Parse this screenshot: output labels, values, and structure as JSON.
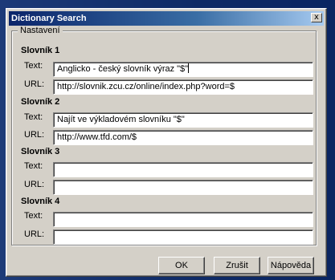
{
  "window": {
    "title": "Dictionary Search",
    "close_glyph": "x"
  },
  "group": {
    "label": "Nastavení"
  },
  "dictionaries": [
    {
      "title": "Slovník 1",
      "text_label": "Text:",
      "url_label": "URL:",
      "text_value": "Anglicko - český slovník výraz \"$\"",
      "url_value": "http://slovnik.zcu.cz/online/index.php?word=$"
    },
    {
      "title": "Slovník 2",
      "text_label": "Text:",
      "url_label": "URL:",
      "text_value": "Najít ve výkladovém slovníku \"$\"",
      "url_value": "http://www.tfd.com/$"
    },
    {
      "title": "Slovník 3",
      "text_label": "Text:",
      "url_label": "URL:",
      "text_value": "",
      "url_value": ""
    },
    {
      "title": "Slovník 4",
      "text_label": "Text:",
      "url_label": "URL:",
      "text_value": "",
      "url_value": ""
    }
  ],
  "buttons": {
    "ok": "OK",
    "cancel": "Zrušit",
    "help": "Nápověda"
  }
}
